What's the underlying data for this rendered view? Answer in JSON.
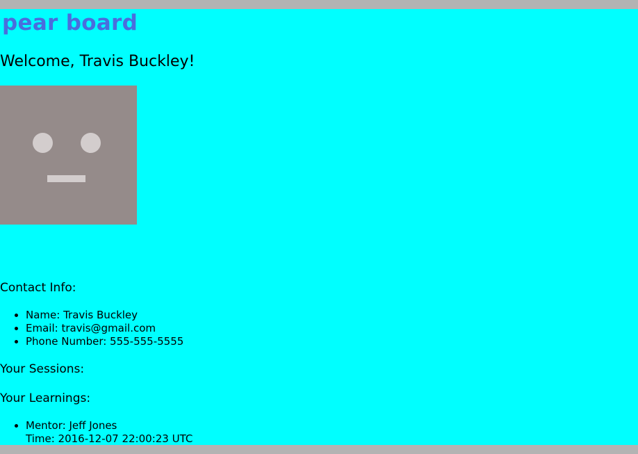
{
  "header": {
    "brand": "pear board",
    "welcome": "Welcome, Travis Buckley!"
  },
  "avatar": {
    "icon": "robot-face-icon"
  },
  "contact": {
    "heading": "Contact Info:",
    "items": [
      "Name: Travis Buckley",
      "Email: travis@gmail.com",
      "Phone Number: 555-555-5555"
    ]
  },
  "sessions": {
    "heading": "Your Sessions:"
  },
  "learnings": {
    "heading": "Your Learnings:",
    "items": [
      {
        "mentor": "Mentor: Jeff Jones",
        "time": "Time: 2016-12-07 22:00:23 UTC"
      }
    ]
  },
  "colors": {
    "page_background": "#00ffff",
    "frame": "#b3b3b3",
    "brand": "#4a6ddd",
    "avatar_background": "#958b8a",
    "avatar_features": "#d3cdcd"
  }
}
